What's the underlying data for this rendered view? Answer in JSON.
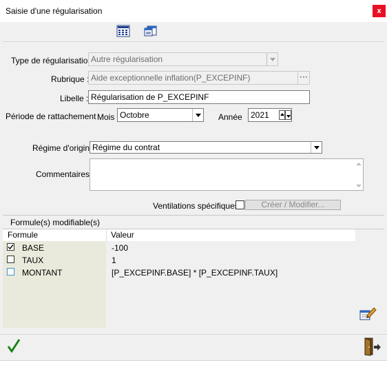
{
  "window": {
    "title": "Saisie d'une régularisation",
    "close_label": "x"
  },
  "toolbar": {
    "icons": [
      "calculator-icon",
      "window-list-icon"
    ]
  },
  "form": {
    "type_label": "Type de régularisation",
    "type_value": "Autre régularisation",
    "rubrique_label": "Rubrique :",
    "rubrique_value": "Aide exceptionnelle inflation(P_EXCEPINF)",
    "rubrique_button": "···",
    "libelle_label": "Libelle :",
    "libelle_value": "Régularisation de P_EXCEPINF",
    "periode_label": "Période de rattachement",
    "mois_label": "Mois",
    "mois_value": "Octobre",
    "annee_label": "Année",
    "annee_value": "2021",
    "regime_label": "Régime d'origine",
    "regime_value": "Régime du contrat",
    "commentaires_label": "Commentaires :",
    "commentaires_value": "",
    "ventilations_label": "Ventilations spécifiques",
    "creer_button": "Créer / Modifier..."
  },
  "formules": {
    "group_title": "Formule(s) modifiable(s)",
    "columns": [
      "Formule",
      "Valeur"
    ],
    "rows": [
      {
        "name": "BASE",
        "value": "-100",
        "checked": true
      },
      {
        "name": "TAUX",
        "value": "1",
        "checked": false
      },
      {
        "name": "MONTANT",
        "value": "[P_EXCEPINF.BASE] * [P_EXCEPINF.TAUX]",
        "checked": false
      }
    ]
  },
  "footer": {
    "validate_icon": "checkmark-icon",
    "exit_icon": "exit-door-icon",
    "edit_icon": "edit-formula-icon"
  },
  "colors": {
    "close": "#e81123",
    "validate": "#2a9d2a",
    "grid_bg": "#eaeadc"
  }
}
